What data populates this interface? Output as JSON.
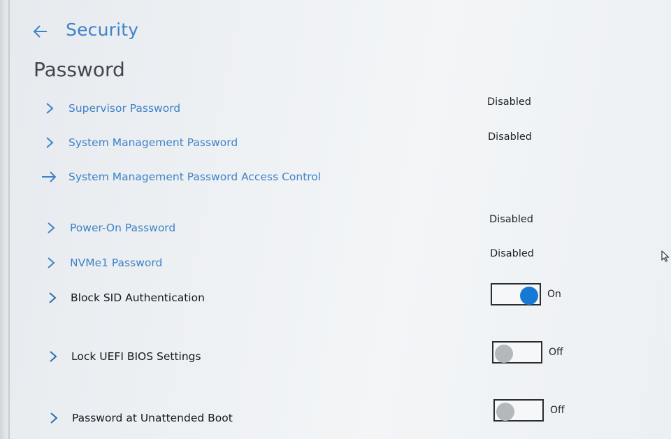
{
  "header": {
    "section": "Security",
    "page_title": "Password"
  },
  "rows": [
    {
      "label": "Supervisor Password",
      "status": "Disabled"
    },
    {
      "label": "System Management Password",
      "status": "Disabled"
    },
    {
      "label": "System Management Password Access Control"
    },
    {
      "label": "Power-On Password",
      "status": "Disabled"
    },
    {
      "label": "NVMe1 Password",
      "status": "Disabled"
    },
    {
      "label": "Block SID Authentication",
      "toggle": "On"
    },
    {
      "label": "Lock UEFI BIOS Settings",
      "toggle": "Off"
    },
    {
      "label": "Password at Unattended Boot",
      "toggle": "Off"
    }
  ],
  "colors": {
    "accent": "#3f82c7",
    "toggle_on": "#1679d4",
    "toggle_off_knob": "#b5b8bb"
  },
  "icons": {
    "back": "arrow-left-icon",
    "expand": "chevron-right-icon",
    "navigate": "arrow-right-icon",
    "pointer": "mouse-cursor-icon"
  }
}
